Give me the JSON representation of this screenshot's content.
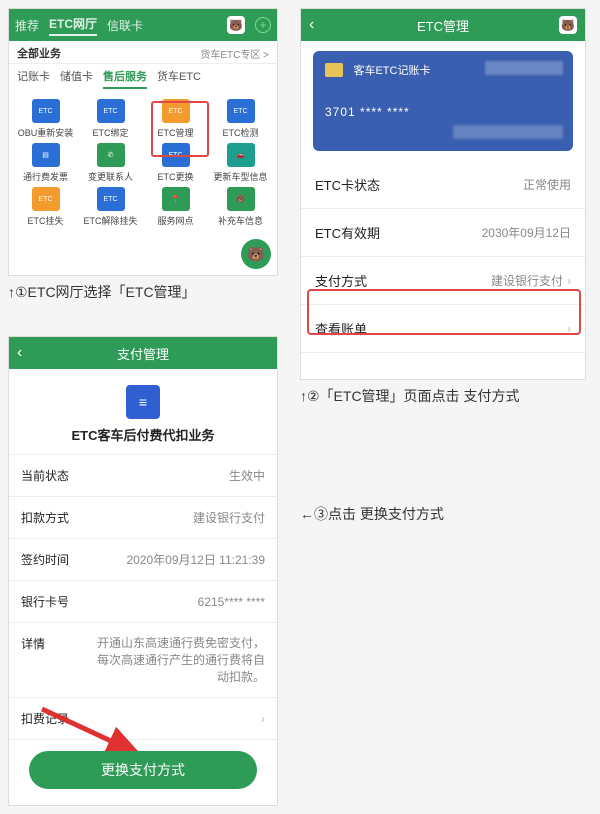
{
  "panel1": {
    "header_tabs": [
      "推荐",
      "ETC网厅",
      "信联卡"
    ],
    "header_active": 1,
    "sub_left": "全部业务",
    "sub_right": "货车ETC专区 >",
    "cat_tabs": [
      "记账卡",
      "储值卡",
      "售后服务",
      "货车ETC"
    ],
    "cat_active": 2,
    "grid": [
      {
        "label": "OBU重新安装",
        "color": "blue",
        "txt": "ETC"
      },
      {
        "label": "ETC绑定",
        "color": "blue",
        "txt": "ETC"
      },
      {
        "label": "ETC管理",
        "color": "orange",
        "txt": "ETC"
      },
      {
        "label": "ETC检测",
        "color": "blue",
        "txt": "ETC"
      },
      {
        "label": "通行费发票",
        "color": "blue",
        "txt": "▤"
      },
      {
        "label": "变更联系人",
        "color": "green",
        "txt": "✆"
      },
      {
        "label": "ETC更换",
        "color": "blue",
        "txt": "ETC"
      },
      {
        "label": "更新车型信息",
        "color": "teal",
        "txt": "🚗"
      },
      {
        "label": "ETC挂失",
        "color": "orange",
        "txt": "ETC"
      },
      {
        "label": "ETC解除挂失",
        "color": "blue",
        "txt": "ETC"
      },
      {
        "label": "服务网点",
        "color": "green",
        "txt": "📍"
      },
      {
        "label": "补充车信息",
        "color": "green",
        "txt": "🐻"
      }
    ]
  },
  "panel2": {
    "title": "ETC管理",
    "card_name": "客车ETC记账卡",
    "card_num": "3701 **** ****",
    "rows": [
      {
        "k": "ETC卡状态",
        "v": "正常使用",
        "chev": false
      },
      {
        "k": "ETC有效期",
        "v": "2030年09月12日",
        "chev": false
      },
      {
        "k": "支付方式",
        "v": "建设银行支付",
        "chev": true
      },
      {
        "k": "查看账单",
        "v": "",
        "chev": true
      }
    ]
  },
  "panel3": {
    "title": "支付管理",
    "biz_title": "ETC客车后付费代扣业务",
    "rows": [
      {
        "k": "当前状态",
        "v": "生效中"
      },
      {
        "k": "扣款方式",
        "v": "建设银行支付"
      },
      {
        "k": "签约时间",
        "v": "2020年09月12日 11:21:39"
      },
      {
        "k": "银行卡号",
        "v": "6215**** ****"
      },
      {
        "k": "详情",
        "v": "开通山东高速通行费免密支付，每次高速通行产生的通行费将自动扣款。"
      },
      {
        "k": "扣费记录",
        "v": ""
      }
    ],
    "button": "更换支付方式"
  },
  "captions": {
    "c1": "↑①ETC网厅选择「ETC管理」",
    "c2": "↑②「ETC管理」页面点击 支付方式",
    "c3": "←③点击 更换支付方式"
  }
}
